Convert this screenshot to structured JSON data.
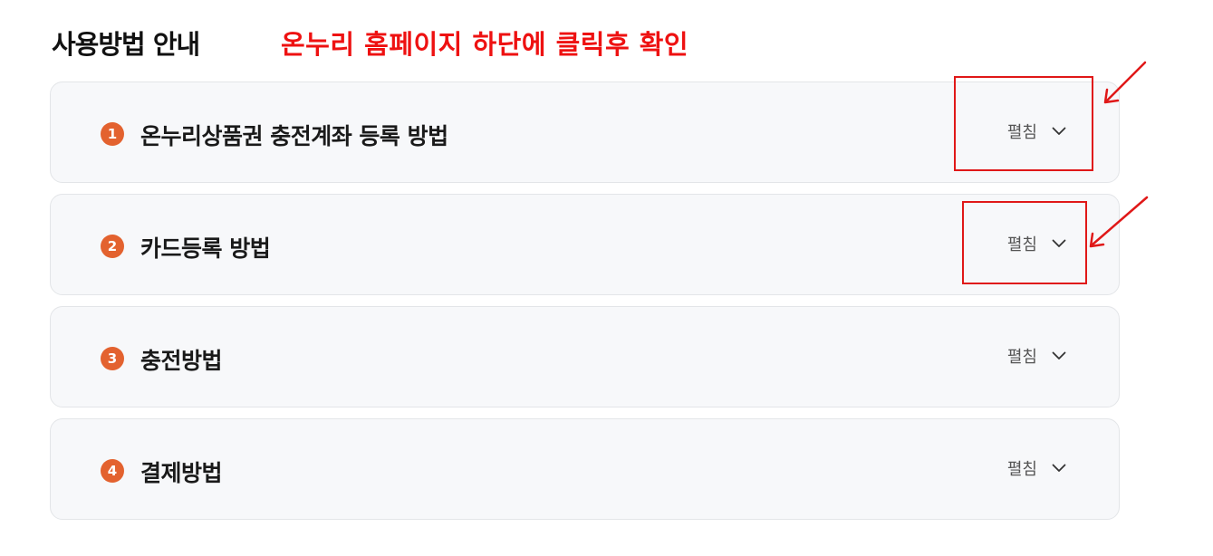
{
  "header": {
    "title": "사용방법 안내",
    "annotation": "온누리 홈페이지 하단에 클릭후 확인"
  },
  "accordion": {
    "items": [
      {
        "number": "1",
        "label": "온누리상품권 충전계좌 등록 방법",
        "toggle_label": "펼침"
      },
      {
        "number": "2",
        "label": "카드등록 방법",
        "toggle_label": "펼침"
      },
      {
        "number": "3",
        "label": "충전방법",
        "toggle_label": "펼침"
      },
      {
        "number": "4",
        "label": "결제방법",
        "toggle_label": "펼침"
      }
    ]
  },
  "icons": {
    "toggle": "chevron-down-icon",
    "annotation_marker": "arrow-icon"
  },
  "colors": {
    "annotation": "#ee1111",
    "number_badge": "#e3622f",
    "item_background": "#f7f8fa",
    "item_border": "#e3e5e8",
    "highlight_box": "#e01818"
  }
}
